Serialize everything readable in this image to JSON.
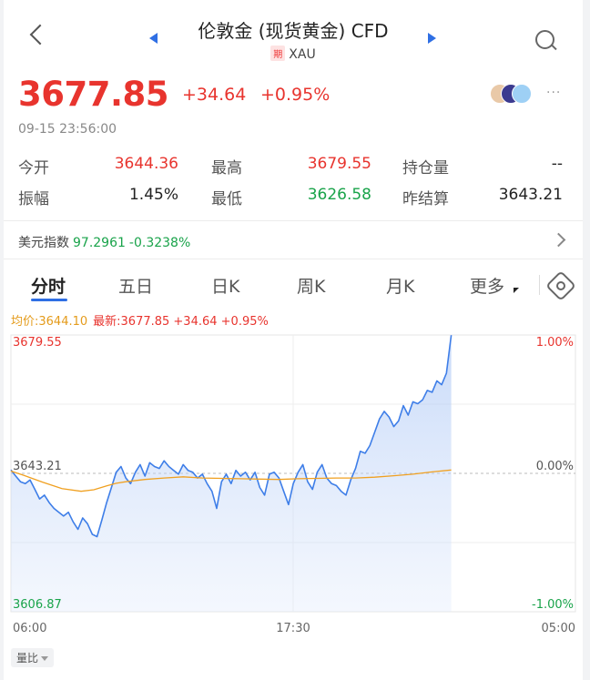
{
  "header": {
    "title": "伦敦金 (现货黄金) CFD",
    "badge": "期",
    "symbol": "XAU"
  },
  "quote": {
    "price": "3677.85",
    "change": "+34.64",
    "change_pct": "+0.95%",
    "timestamp": "09-15 23:56:00"
  },
  "stats": [
    {
      "label": "今开",
      "value": "3644.36",
      "color": "#e8342e"
    },
    {
      "label": "最高",
      "value": "3679.55",
      "color": "#e8342e"
    },
    {
      "label": "持仓量",
      "value": "--",
      "color": "#222222"
    },
    {
      "label": "振幅",
      "value": "1.45%",
      "color": "#222222"
    },
    {
      "label": "最低",
      "value": "3626.58",
      "color": "#19a34a"
    },
    {
      "label": "昨结算",
      "value": "3643.21",
      "color": "#222222"
    }
  ],
  "usd_index": {
    "label": "美元指数",
    "value": "97.2961",
    "change": "-0.3238%"
  },
  "tabs": [
    "分时",
    "五日",
    "日K",
    "周K",
    "月K",
    "更多"
  ],
  "legend": {
    "avg": "均价:3644.10",
    "last": "最新:3677.85 +34.64 +0.95%"
  },
  "volume_button": "量比",
  "colors": {
    "up": "#e8342e",
    "down": "#19a34a",
    "price_line": "#3e7ee8",
    "avg_line": "#f0a020",
    "accent": "#2f6fe4"
  },
  "chart_data": {
    "type": "line",
    "ylim": [
      3606.87,
      3679.55
    ],
    "prev_close": 3643.21,
    "y_tick_labels_left": [
      "3679.55",
      "3643.21",
      "3606.87"
    ],
    "y_tick_labels_right": [
      "1.00%",
      "0.00%",
      "-1.00%"
    ],
    "x_tick_labels": [
      "06:00",
      "17:30",
      "05:00"
    ],
    "x_range": [
      0,
      1380
    ],
    "series": [
      {
        "x": [
          0,
          15,
          30,
          45,
          60,
          75,
          90,
          105,
          120,
          135,
          150,
          165,
          180,
          195,
          210,
          225,
          240,
          255,
          270,
          285,
          300,
          315,
          330,
          345,
          360,
          375,
          390,
          405,
          420,
          435,
          450,
          465,
          480,
          495,
          510,
          525,
          540,
          555,
          570,
          585,
          600,
          615,
          630,
          645,
          660,
          675,
          690,
          705,
          720,
          735,
          750,
          765,
          780,
          795,
          810,
          825,
          840,
          855,
          870,
          885,
          900,
          915,
          930,
          945,
          960,
          975,
          990,
          1005,
          1020,
          1035,
          1050,
          1065,
          1080,
          1095,
          1110,
          1125,
          1140,
          1155,
          1170,
          1185,
          1200,
          1215,
          1230,
          1245,
          1260,
          1275,
          1290,
          1305,
          1320,
          1335,
          1350,
          1365,
          1380
        ],
        "values": [
          3644.1,
          3642.5,
          3641.0,
          3640.5,
          3641.5,
          3639.0,
          3636.5,
          3637.5,
          3635.5,
          3634.0,
          3633.0,
          3632.0,
          3633.0,
          3630.5,
          3628.5,
          3631.5,
          3630.0,
          3627.2,
          3626.6,
          3631.0,
          3635.5,
          3639.5,
          3643.5,
          3645.0,
          3642.0,
          3640.5,
          3643.5,
          3645.5,
          3642.5,
          3646.0,
          3645.0,
          3644.5,
          3646.5,
          3645.0,
          3644.0,
          3643.0,
          3645.5,
          3644.0,
          3643.5,
          3642.0,
          3643.0,
          3640.5,
          3638.5,
          3634.0,
          3641.0,
          3643.0,
          3640.5,
          3644.0,
          3642.5,
          3643.5,
          3641.5,
          3643.5,
          3639.5,
          3637.5,
          3643.0,
          3643.5,
          3642.0,
          3638.5,
          3635.0,
          3640.5,
          3643.5,
          3645.5,
          3641.0,
          3639.0,
          3643.5,
          3645.5,
          3642.0,
          3640.5,
          3640.0,
          3638.5,
          3637.5,
          3641.5,
          3644.5,
          3649.0,
          3648.5,
          3650.5,
          3654.0,
          3657.5,
          3659.5,
          3658.0,
          3655.5,
          3657.0,
          3661.0,
          3658.5,
          3662.0,
          3661.5,
          3662.5,
          3665.0,
          3664.5,
          3667.5,
          3666.5,
          3669.5,
          3679.5
        ]
      },
      {
        "x": [
          0,
          40,
          100,
          160,
          220,
          260,
          300,
          330,
          360,
          420,
          480,
          540,
          600,
          660,
          720,
          780,
          840,
          900,
          960,
          1020,
          1080,
          1140,
          1200,
          1260,
          1320,
          1380
        ],
        "values": [
          3643.8,
          3642.7,
          3640.9,
          3639.2,
          3638.5,
          3638.9,
          3639.9,
          3640.6,
          3641.0,
          3641.6,
          3642.0,
          3642.3,
          3642.0,
          3641.9,
          3641.8,
          3641.7,
          3641.6,
          3641.8,
          3641.9,
          3642.0,
          3642.0,
          3642.2,
          3642.6,
          3643.0,
          3643.6,
          3644.1
        ]
      }
    ]
  }
}
